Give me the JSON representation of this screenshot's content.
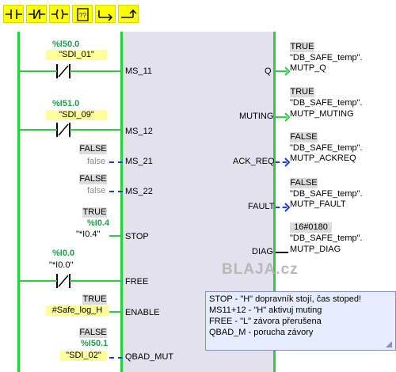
{
  "toolbar": {
    "buttons": [
      {
        "icon": "no-contact-icon"
      },
      {
        "icon": "nc-contact-icon"
      },
      {
        "icon": "coil-icon"
      },
      {
        "icon": "empty-box-icon",
        "label": "??"
      },
      {
        "icon": "open-branch-icon"
      },
      {
        "icon": "close-branch-icon"
      }
    ]
  },
  "block": {
    "inputs": [
      {
        "pin": "MS_11"
      },
      {
        "pin": "MS_12"
      },
      {
        "pin": "MS_21"
      },
      {
        "pin": "MS_22"
      },
      {
        "pin": "STOP"
      },
      {
        "pin": "FREE"
      },
      {
        "pin": "ENABLE"
      },
      {
        "pin": "QBAD_MUT"
      }
    ],
    "outputs": [
      {
        "pin": "Q"
      },
      {
        "pin": "MUTING"
      },
      {
        "pin": "ACK_REQ"
      },
      {
        "pin": "FAULT"
      },
      {
        "pin": "DIAG"
      }
    ]
  },
  "left": {
    "ms11": {
      "address": "%I50.0",
      "symbol": "\"SDI_01\""
    },
    "ms12": {
      "address": "%I51.0",
      "symbol": "\"SDI_09\""
    },
    "ms21": {
      "status": "FALSE",
      "value": "false"
    },
    "ms22": {
      "status": "FALSE",
      "value": "false"
    },
    "stop": {
      "status": "TRUE",
      "address": "%I0.4",
      "symbol": "\"*I0.4\""
    },
    "free": {
      "address": "%I0.0",
      "symbol": "\"*I0.0\""
    },
    "enable": {
      "status": "TRUE",
      "symbol": "#Safe_log_H"
    },
    "qbad": {
      "status": "FALSE",
      "address": "%I50.1",
      "symbol": "\"SDI_02\""
    }
  },
  "right": {
    "q": {
      "status": "TRUE",
      "db": "\"DB_SAFE_temp\".",
      "member": "MUTP_Q"
    },
    "muting": {
      "status": "TRUE",
      "db": "\"DB_SAFE_temp\".",
      "member": "MUTP_MUTING"
    },
    "ackreq": {
      "status": "FALSE",
      "db": "\"DB_SAFE_temp\".",
      "member": "MUTP_ACKREQ"
    },
    "fault": {
      "status": "FALSE",
      "db": "\"DB_SAFE_temp\".",
      "member": "MUTP_FAULT"
    },
    "diag": {
      "status": "16#0180",
      "db": "\"DB_SAFE_temp\".",
      "member": "MUTP_DIAG"
    }
  },
  "comment": {
    "lines": [
      "STOP - \"H\" dopravník stojí, čas stoped!",
      "MS11+12 - \"H\" aktivuj muting",
      "FREE - \"L\" závora přerušena",
      "QBAD_M - porucha závory"
    ]
  },
  "watermark": "BLAJA.cz",
  "colors": {
    "energized": "#2ecc40",
    "not_energized": "#1a3cd6",
    "block_bg": "#e3e1ee",
    "toolbar_button": "#ffff00"
  }
}
